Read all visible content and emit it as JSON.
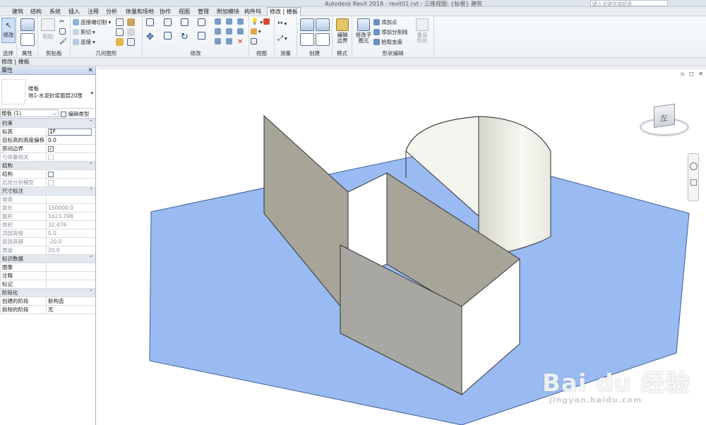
{
  "titlebar": {
    "title": "Autodesk Revit 2018 -    revit01.rvt - 三维视图: {标根} 建筑",
    "search_placeholder": "键入关键字或短语"
  },
  "ribbon_tabs": [
    "建筑",
    "结构",
    "系统",
    "插入",
    "注释",
    "分析",
    "体量和场地",
    "协作",
    "视图",
    "管理",
    "附加模块",
    "构件坞",
    "修改 | 楼板"
  ],
  "ribbon": {
    "modify_label": "修改",
    "select_label": "选择",
    "properties_label": "属性",
    "clipboard": {
      "paste": "粘贴",
      "label": "剪贴板"
    },
    "geometry": {
      "join_geometry": "连接端切割",
      "cut": "剪切",
      "join": "连接",
      "label": "几何图形"
    },
    "modify_group_label": "修改",
    "view_group_label": "视图",
    "measure_group_label": "测量",
    "create_group_label": "创建",
    "mode": {
      "edit_boundary": "编辑边界",
      "label": "模式"
    },
    "shape_edit": {
      "modify_subelements": "修改子图元",
      "add_point": "添加点",
      "add_split_line": "添加分割线",
      "pick_supports": "拾取支座",
      "reset_shape": "重设形状",
      "label": "形状编辑"
    }
  },
  "context_bar": "修改 | 楼板",
  "properties": {
    "header": "属性",
    "family": "楼板",
    "type": "地1-水泥砂浆面层20厚",
    "instance_selector": "楼板 (1)",
    "edit_type": "编辑类型",
    "categories": [
      {
        "name": "约束",
        "rows": [
          {
            "k": "标高",
            "v": "1F",
            "kind": "input"
          },
          {
            "k": "自标高的高度偏移",
            "v": "0.0",
            "kind": "text"
          },
          {
            "k": "房间边界",
            "v": "✓",
            "kind": "check"
          },
          {
            "k": "与体量相关",
            "v": "",
            "kind": "check-dis"
          }
        ]
      },
      {
        "name": "结构",
        "rows": [
          {
            "k": "结构",
            "v": "",
            "kind": "check"
          },
          {
            "k": "启用分析模型",
            "v": "",
            "kind": "check-dis"
          }
        ]
      },
      {
        "name": "尺寸标注",
        "rows": [
          {
            "k": "坡度",
            "v": "",
            "kind": "dis"
          },
          {
            "k": "周长",
            "v": "150000.0",
            "kind": "dis"
          },
          {
            "k": "面积",
            "v": "1623.798",
            "kind": "dis"
          },
          {
            "k": "体积",
            "v": "32.476",
            "kind": "dis"
          },
          {
            "k": "顶部高程",
            "v": "0.0",
            "kind": "dis"
          },
          {
            "k": "底部高程",
            "v": "-20.0",
            "kind": "dis"
          },
          {
            "k": "厚度",
            "v": "20.0",
            "kind": "dis"
          }
        ]
      },
      {
        "name": "标识数据",
        "rows": [
          {
            "k": "图像",
            "v": "",
            "kind": "text"
          },
          {
            "k": "注释",
            "v": "",
            "kind": "text"
          },
          {
            "k": "标记",
            "v": "",
            "kind": "text"
          }
        ]
      },
      {
        "name": "阶段化",
        "rows": [
          {
            "k": "创建的阶段",
            "v": "新构造",
            "kind": "text"
          },
          {
            "k": "拆除的阶段",
            "v": "无",
            "kind": "text"
          }
        ]
      }
    ]
  },
  "viewcube": {
    "face": "左"
  },
  "watermark": {
    "brand": "Bai du 经验",
    "url": "jingyan.baidu.com"
  },
  "colors": {
    "floor": "#99bbf2",
    "floor_edge": "#3f5f99",
    "wall_gray": "#a7a498",
    "accent": "#2f6db5"
  }
}
